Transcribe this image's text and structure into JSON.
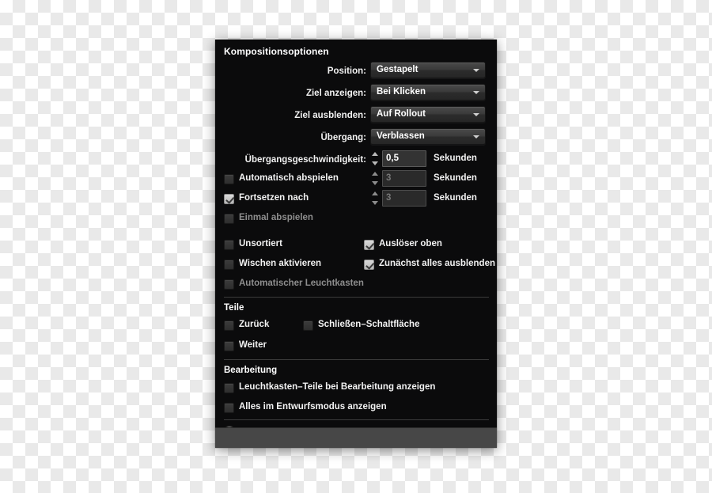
{
  "panel": {
    "title": "Kompositionsoptionen",
    "help_icon": "help-question-icon",
    "help_glyph": "?"
  },
  "fields": [
    {
      "label": "Position:",
      "type": "popup",
      "value": "Gestapelt",
      "name": "position-dropdown"
    },
    {
      "label": "Ziel anzeigen:",
      "type": "popup",
      "value": "Bei Klicken",
      "name": "show-target-dropdown"
    },
    {
      "label": "Ziel ausblenden:",
      "type": "popup",
      "value": "Auf Rollout",
      "name": "hide-target-dropdown"
    },
    {
      "label": "Übergang:",
      "type": "popup",
      "value": "Verblassen",
      "name": "transition-dropdown"
    }
  ],
  "speed_row": {
    "label": "Übergangsgeschwindigkeit:",
    "value": "0,5",
    "unit": "Sekunden",
    "enabled": true
  },
  "auto_play_row": {
    "label": "Automatisch abspielen",
    "checked": false,
    "value": "3",
    "unit": "Sekunden",
    "enabled": false
  },
  "resume_row": {
    "label": "Fortsetzen nach",
    "checked": true,
    "value": "3",
    "unit": "Sekunden",
    "enabled": false
  },
  "play_once_row": {
    "label": "Einmal abspielen",
    "checked": false,
    "disabled": true
  },
  "options_left": [
    {
      "label": "Unsortiert",
      "checked": false,
      "disabled": false,
      "name": "checkbox-unsorted"
    },
    {
      "label": "Wischen aktivieren",
      "checked": false,
      "disabled": false,
      "name": "checkbox-enable-swipe"
    },
    {
      "label": "Automatischer Leuchtkasten",
      "checked": false,
      "disabled": true,
      "name": "checkbox-auto-lightbox"
    }
  ],
  "options_right": [
    {
      "label": "Auslöser oben",
      "checked": true,
      "disabled": false,
      "name": "checkbox-trigger-on-top"
    },
    {
      "label": "Zunächst alles ausblenden",
      "checked": true,
      "disabled": false,
      "name": "checkbox-hide-all-initially"
    }
  ],
  "parts_section": {
    "heading": "Teile",
    "items_col1": [
      {
        "label": "Zurück",
        "checked": false,
        "name": "checkbox-part-back"
      },
      {
        "label": "Weiter",
        "checked": false,
        "name": "checkbox-part-next"
      }
    ],
    "items_col2": [
      {
        "label": "Schließen–Schaltfläche",
        "checked": false,
        "name": "checkbox-part-close-button"
      }
    ]
  },
  "editing_section": {
    "heading": "Bearbeitung",
    "items": [
      {
        "label": "Leuchtkasten–Teile bei Bearbeitung anzeigen",
        "checked": false,
        "name": "checkbox-show-lightbox-parts-editing"
      },
      {
        "label": "Alles im Entwurfsmodus anzeigen",
        "checked": false,
        "name": "checkbox-show-all-draft-mode"
      }
    ]
  },
  "colors": {
    "panel_bg": "#0b0b0c",
    "footer_bg": "#474747",
    "text": "#f2f2f2",
    "text_disabled": "#8e8e8e",
    "divider": "#3c3c3c"
  }
}
